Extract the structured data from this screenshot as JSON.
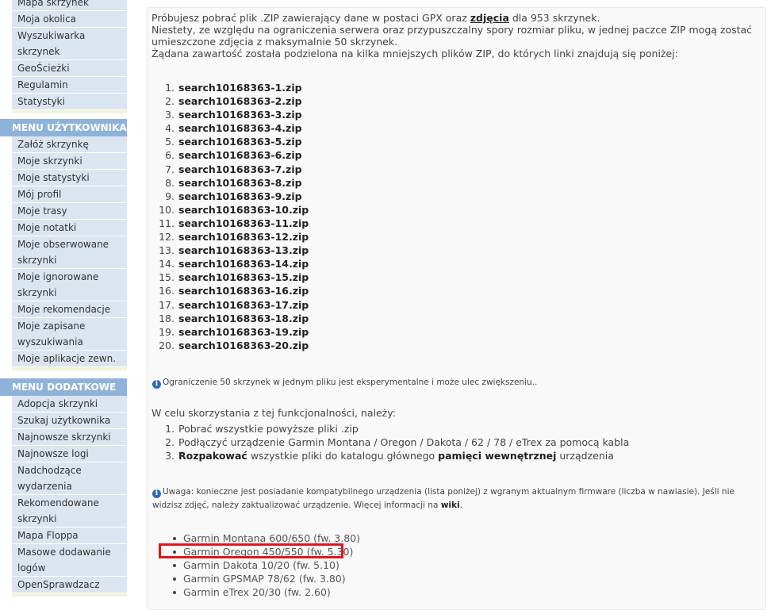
{
  "sidebar": {
    "top_items": [
      {
        "lines": [
          "Mapa skrzynek"
        ]
      },
      {
        "lines": [
          "Moja okolica"
        ]
      },
      {
        "lines": [
          "Wyszukiwarka",
          "skrzynek"
        ]
      },
      {
        "lines": [
          "GeoŚcieżki"
        ]
      },
      {
        "lines": [
          "Regulamin"
        ]
      },
      {
        "lines": [
          "Statystyki"
        ]
      }
    ],
    "user_menu_title": "MENU UŻYTKOWNIKA",
    "user_items": [
      {
        "lines": [
          "Załóż skrzynkę"
        ]
      },
      {
        "lines": [
          "Moje skrzynki"
        ]
      },
      {
        "lines": [
          "Moje statystyki"
        ]
      },
      {
        "lines": [
          "Mój profil"
        ]
      },
      {
        "lines": [
          "Moje trasy"
        ]
      },
      {
        "lines": [
          "Moje notatki"
        ]
      },
      {
        "lines": [
          "Moje obserwowane",
          "skrzynki"
        ]
      },
      {
        "lines": [
          "Moje ignorowane",
          "skrzynki"
        ]
      },
      {
        "lines": [
          "Moje rekomendacje"
        ]
      },
      {
        "lines": [
          "Moje zapisane",
          "wyszukiwania"
        ]
      },
      {
        "lines": [
          "Moje aplikacje zewn."
        ]
      }
    ],
    "extra_menu_title": "MENU DODATKOWE",
    "extra_items": [
      {
        "lines": [
          "Adopcja skrzynki"
        ]
      },
      {
        "lines": [
          "Szukaj użytkownika"
        ]
      },
      {
        "lines": [
          "Najnowsze skrzynki"
        ]
      },
      {
        "lines": [
          "Najnowsze logi"
        ]
      },
      {
        "lines": [
          "Nadchodzące",
          "wydarzenia"
        ]
      },
      {
        "lines": [
          "Rekomendowane",
          "skrzynki"
        ]
      },
      {
        "lines": [
          "Mapa Floppa"
        ]
      },
      {
        "lines": [
          "Masowe dodawanie",
          "logów"
        ]
      },
      {
        "lines": [
          "OpenSprawdzacz"
        ]
      }
    ]
  },
  "main": {
    "intro": {
      "line1_before": "Próbujesz pobrać plik .ZIP zawierający dane w postaci GPX oraz ",
      "line1_link": "zdjęcia",
      "line1_after": " dla 953 skrzynek.",
      "line2": "Niestety, ze względu na ograniczenia serwera oraz przypuszczalny spory rozmiar pliku, w jednej paczce ZIP mogą zostać umieszczone zdjęcia z maksymalnie 50 skrzynek.",
      "line3": "Żądana zawartość została podzielona na kilka mniejszych plików ZIP, do których linki znajdują się poniżej:"
    },
    "zip_files": [
      {
        "num": "1.",
        "name": "search10168363-1.zip"
      },
      {
        "num": "2.",
        "name": "search10168363-2.zip"
      },
      {
        "num": "3.",
        "name": "search10168363-3.zip"
      },
      {
        "num": "4.",
        "name": "search10168363-4.zip"
      },
      {
        "num": "5.",
        "name": "search10168363-5.zip"
      },
      {
        "num": "6.",
        "name": "search10168363-6.zip"
      },
      {
        "num": "7.",
        "name": "search10168363-7.zip"
      },
      {
        "num": "8.",
        "name": "search10168363-8.zip"
      },
      {
        "num": "9.",
        "name": "search10168363-9.zip"
      },
      {
        "num": "10.",
        "name": "search10168363-10.zip"
      },
      {
        "num": "11.",
        "name": "search10168363-11.zip"
      },
      {
        "num": "12.",
        "name": "search10168363-12.zip"
      },
      {
        "num": "13.",
        "name": "search10168363-13.zip"
      },
      {
        "num": "14.",
        "name": "search10168363-14.zip"
      },
      {
        "num": "15.",
        "name": "search10168363-15.zip"
      },
      {
        "num": "16.",
        "name": "search10168363-16.zip"
      },
      {
        "num": "17.",
        "name": "search10168363-17.zip"
      },
      {
        "num": "18.",
        "name": "search10168363-18.zip"
      },
      {
        "num": "19.",
        "name": "search10168363-19.zip"
      },
      {
        "num": "20.",
        "name": "search10168363-20.zip"
      }
    ],
    "info_icon_glyph": "i",
    "limit_note": "Ograniczenie 50 skrzynek w jednym pliku jest eksperymentalne i może ulec zwiększeniu..",
    "howto_title": "W celu skorzystania z tej funkcjonalności, należy:",
    "steps": {
      "s1_num": "1.",
      "s1_text": "Pobrać wszystkie powyższe pliki .zip",
      "s2_num": "2.",
      "s2_text": "Podłączyć urządzenie Garmin Montana / Oregon / Dakota / 62 / 78 / eTrex za pomocą kabla",
      "s3_num": "3.",
      "s3_bold1": "Rozpakować",
      "s3_mid": " wszystkie pliki do katalogu głównego ",
      "s3_bold2": "pamięci wewnętrznej",
      "s3_end": " urządzenia"
    },
    "warning": {
      "text": "Uwaga: konieczne jest posiadanie kompatybilnego urządzenia (lista poniżej) z wgranym aktualnym firmware (liczba w nawiasie). Jeśli nie widzisz zdjęć, należy zaktualizować urządzenie. Więcej informacji na ",
      "link": "wiki",
      "end": "."
    },
    "devices": [
      "Garmin Montana 600/650 (fw. 3.80)",
      "Garmin Oregon 450/550 (fw. 5.30)",
      "Garmin Dakota 10/20 (fw. 5.10)",
      "Garmin GPSMAP 78/62 (fw. 3.80)",
      "Garmin eTrex 20/30 (fw. 2.60)"
    ],
    "highlight_color": "#e2161c"
  }
}
